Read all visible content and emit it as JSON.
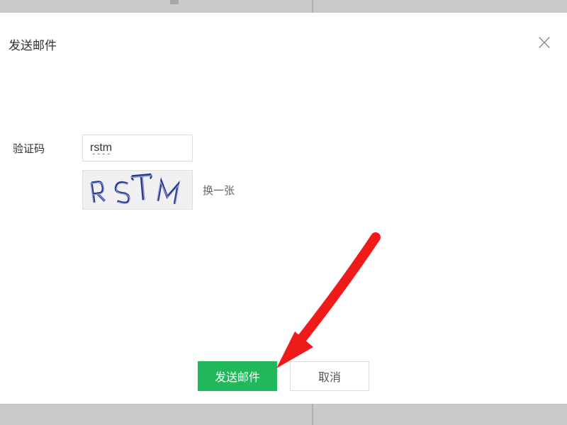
{
  "modal": {
    "title": "发送邮件",
    "captcha_label": "验证码",
    "captcha_input_value": "rstm",
    "captcha_text": "RSTM",
    "refresh_label": "换一张",
    "send_button": "发送邮件",
    "cancel_button": "取消"
  }
}
